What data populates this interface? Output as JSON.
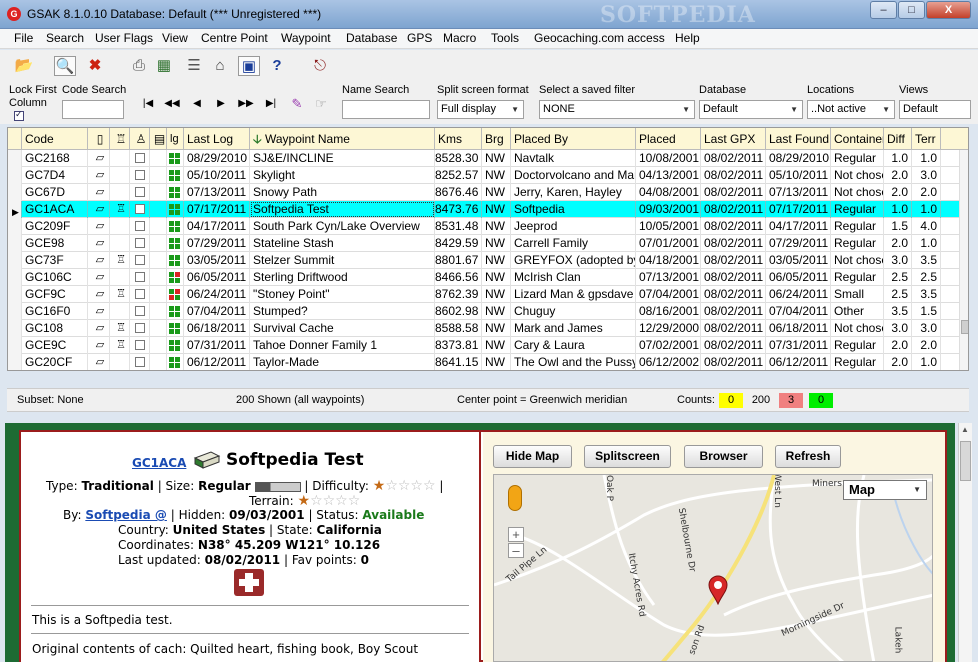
{
  "title": "GSAK 8.1.0.10    Database: Default    (*** Unregistered ***)",
  "watermark": "SOFTPEDIA",
  "window_buttons": {
    "minimize": "–",
    "maximize": "□",
    "close": "X"
  },
  "menu": [
    "File",
    "Search",
    "User Flags",
    "View",
    "Centre Point",
    "Waypoint",
    "Database",
    "GPS",
    "Macro",
    "Tools",
    "Geocaching.com access",
    "Help"
  ],
  "toolbar_icons": [
    "open-folder-icon",
    "preview-icon",
    "delete-icon",
    "print-icon",
    "grid-icon",
    "split-icon",
    "home-icon",
    "window-icon",
    "help-icon",
    "exit-icon"
  ],
  "filters": {
    "lock_first_label": "Lock First",
    "column_label": "Column",
    "code_search_label": "Code Search",
    "code_search_value": "",
    "name_search_label": "Name Search",
    "name_search_value": "",
    "split_label": "Split screen format",
    "split_value": "Full display",
    "saved_filter_label": "Select a saved filter",
    "saved_filter_value": "NONE",
    "database_label": "Database",
    "database_value": "Default",
    "locations_label": "Locations",
    "locations_value": "..Not active",
    "views_label": "Views",
    "views_value": "Default"
  },
  "nav_buttons": [
    "|◀",
    "◀◀",
    "◀",
    "▶",
    "▶▶",
    "▶|"
  ],
  "grid": {
    "headers": [
      "Code",
      "",
      "",
      "",
      "",
      "lg",
      "Last Log",
      "Waypoint Name",
      "Kms",
      "Brg",
      "Placed By",
      "Placed",
      "Last GPX",
      "Last Found",
      "Container",
      "Diff",
      "Terr"
    ],
    "rows": [
      {
        "code": "GC2168",
        "icon2": false,
        "lastlog": "08/29/2010",
        "name": "SJ&E/INCLINE",
        "kms": "8528.30",
        "brg": "NW",
        "by": "Navtalk",
        "placed": "10/08/2001",
        "gpx": "08/02/2011",
        "found": "08/29/2010",
        "container": "Regular",
        "diff": "1.0",
        "terr": "1.0",
        "lg": [
          "g",
          "g",
          "g",
          "g"
        ]
      },
      {
        "code": "GC7D4",
        "icon2": false,
        "lastlog": "05/10/2011",
        "name": "Skylight",
        "kms": "8252.57",
        "brg": "NW",
        "by": "Doctorvolcano and Marcy",
        "placed": "04/13/2001",
        "gpx": "08/02/2011",
        "found": "05/10/2011",
        "container": "Not chosen",
        "diff": "2.0",
        "terr": "3.0",
        "lg": [
          "g",
          "g",
          "g",
          "g"
        ]
      },
      {
        "code": "GC67D",
        "icon2": false,
        "lastlog": "07/13/2011",
        "name": "Snowy Path",
        "kms": "8676.46",
        "brg": "NW",
        "by": "Jerry, Karen, Hayley",
        "placed": "04/08/2001",
        "gpx": "08/02/2011",
        "found": "07/13/2011",
        "container": "Not chosen",
        "diff": "2.0",
        "terr": "2.0",
        "lg": [
          "g",
          "g",
          "g",
          "g"
        ]
      },
      {
        "code": "GC1ACA",
        "icon2": true,
        "lastlog": "07/17/2011",
        "name": "Softpedia Test",
        "kms": "8473.76",
        "brg": "NW",
        "by": "Softpedia",
        "placed": "09/03/2001",
        "gpx": "08/02/2011",
        "found": "07/17/2011",
        "container": "Regular",
        "diff": "1.0",
        "terr": "1.0",
        "lg": [
          "g",
          "g",
          "g",
          "g"
        ],
        "selected": true
      },
      {
        "code": "GC209F",
        "icon2": false,
        "lastlog": "04/17/2011",
        "name": "South Park Cyn/Lake Overview",
        "kms": "8531.48",
        "brg": "NW",
        "by": "Jeeprod",
        "placed": "10/05/2001",
        "gpx": "08/02/2011",
        "found": "04/17/2011",
        "container": "Regular",
        "diff": "1.5",
        "terr": "4.0",
        "lg": [
          "g",
          "g",
          "g",
          "g"
        ]
      },
      {
        "code": "GCE98",
        "icon2": false,
        "lastlog": "07/29/2011",
        "name": "Stateline Stash",
        "kms": "8429.59",
        "brg": "NW",
        "by": "Carrell Family",
        "placed": "07/01/2001",
        "gpx": "08/02/2011",
        "found": "07/29/2011",
        "container": "Regular",
        "diff": "2.0",
        "terr": "1.0",
        "lg": [
          "g",
          "g",
          "g",
          "g"
        ]
      },
      {
        "code": "GC73F",
        "icon2": true,
        "lastlog": "03/05/2011",
        "name": "Stelzer Summit",
        "kms": "8801.67",
        "brg": "NW",
        "by": "GREYFOX (adopted by N",
        "placed": "04/18/2001",
        "gpx": "08/02/2011",
        "found": "03/05/2011",
        "container": "Not chosen",
        "diff": "3.0",
        "terr": "3.5",
        "lg": [
          "g",
          "g",
          "g",
          "g"
        ]
      },
      {
        "code": "GC106C",
        "icon2": false,
        "lastlog": "06/05/2011",
        "name": "Sterling Driftwood",
        "kms": "8466.56",
        "brg": "NW",
        "by": "McIrish Clan",
        "placed": "07/13/2001",
        "gpx": "08/02/2011",
        "found": "06/05/2011",
        "container": "Regular",
        "diff": "2.5",
        "terr": "2.5",
        "lg": [
          "g",
          "r",
          "g",
          "g"
        ]
      },
      {
        "code": "GCF9C",
        "icon2": true,
        "lastlog": "06/24/2011",
        "name": "\"Stoney Point\"",
        "kms": "8762.39",
        "brg": "NW",
        "by": "Lizard Man & gpsdave",
        "placed": "07/04/2001",
        "gpx": "08/02/2011",
        "found": "06/24/2011",
        "container": "Small",
        "diff": "2.5",
        "terr": "3.5",
        "lg": [
          "g",
          "r",
          "r",
          "g"
        ]
      },
      {
        "code": "GC16F0",
        "icon2": false,
        "lastlog": "07/04/2011",
        "name": "Stumped?",
        "kms": "8602.98",
        "brg": "NW",
        "by": "Chuguy",
        "placed": "08/16/2001",
        "gpx": "08/02/2011",
        "found": "07/04/2011",
        "container": "Other",
        "diff": "3.5",
        "terr": "1.5",
        "lg": [
          "g",
          "g",
          "g",
          "g"
        ]
      },
      {
        "code": "GC108",
        "icon2": true,
        "lastlog": "06/18/2011",
        "name": "Survival Cache",
        "kms": "8588.58",
        "brg": "NW",
        "by": "Mark and James",
        "placed": "12/29/2000",
        "gpx": "08/02/2011",
        "found": "06/18/2011",
        "container": "Not chosen",
        "diff": "3.0",
        "terr": "3.0",
        "lg": [
          "g",
          "g",
          "g",
          "g"
        ]
      },
      {
        "code": "GCE9C",
        "icon2": true,
        "lastlog": "07/31/2011",
        "name": "Tahoe Donner Family 1",
        "kms": "8373.81",
        "brg": "NW",
        "by": "Cary & Laura",
        "placed": "07/02/2001",
        "gpx": "08/02/2011",
        "found": "07/31/2011",
        "container": "Regular",
        "diff": "2.0",
        "terr": "2.0",
        "lg": [
          "g",
          "g",
          "g",
          "g"
        ]
      },
      {
        "code": "GC20CF",
        "icon2": false,
        "lastlog": "06/12/2011",
        "name": "Taylor-Made",
        "kms": "8641.15",
        "brg": "NW",
        "by": "The Owl and the Pussycat",
        "placed": "06/12/2002",
        "gpx": "08/02/2011",
        "found": "06/12/2011",
        "container": "Regular",
        "diff": "2.0",
        "terr": "1.0",
        "lg": [
          "g",
          "g",
          "g",
          "g"
        ]
      }
    ]
  },
  "status": {
    "subset": "Subset: None",
    "shown": "200 Shown (all waypoints)",
    "center": "Center point = Greenwich meridian",
    "counts_label": "Counts:",
    "count_yellow": "0",
    "count_total": "200",
    "count_red": "3",
    "count_green": "0"
  },
  "detail": {
    "code_link": "GC1ACA",
    "name": "Softpedia Test",
    "type_label": "Type:",
    "type_value": "Traditional",
    "size_label": "| Size:",
    "size_value": "Regular",
    "difficulty_label": "| Difficulty:",
    "terrain_label": "Terrain:",
    "by_label": "By:",
    "by_value": "Softpedia @",
    "hidden_label": "| Hidden:",
    "hidden_value": "09/03/2001",
    "status_label": "| Status:",
    "status_value": "Available",
    "country_label": "Country:",
    "country_value": "United States",
    "state_label": "| State:",
    "state_value": "California",
    "coords_label": "Coordinates:",
    "coords_value": "N38° 45.209 W121° 10.126",
    "updated_label": "Last updated:",
    "updated_value": "08/02/2011",
    "fav_label": "| Fav points:",
    "fav_value": "0",
    "description": "This is a Softpedia test.",
    "contents": "Original contents of cach: Quilted heart, fishing book, Boy Scout",
    "difficulty_stars": 1,
    "terrain_stars": 1
  },
  "map": {
    "hide_map": "Hide Map",
    "splitscreen": "Splitscreen",
    "browser": "Browser",
    "refresh": "Refresh",
    "map_type": "Map",
    "zoom_in": "+",
    "zoom_out": "–",
    "labels": [
      "Oak P",
      "West Ln",
      "Miners",
      "Shelbourne Dr",
      "Tail Pipe Ln",
      "Itchy Acres Rd",
      "Morningside Dr",
      "Lakeh",
      "son Rd"
    ]
  },
  "colors": {
    "selected_row": "#00ffff",
    "grid_header": "#fdf7d5",
    "detail_bg": "#1d6b33",
    "border_red": "#9b1c1c",
    "link": "#1a4bb3"
  }
}
